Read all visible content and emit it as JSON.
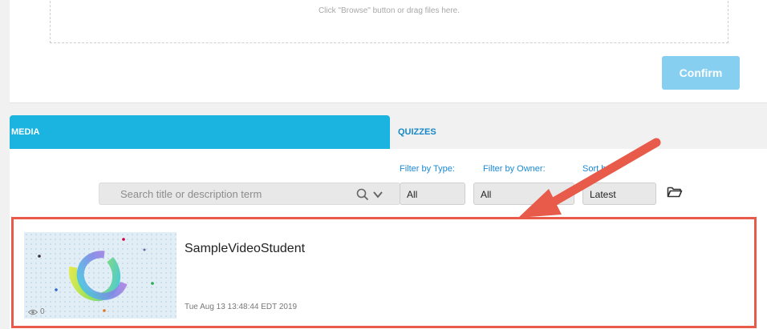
{
  "upload": {
    "dropzone_text": "Click \"Browse\" button or drag files here.",
    "confirm_label": "Confirm"
  },
  "tabs": [
    {
      "label": "MEDIA",
      "active": true
    },
    {
      "label": "QUIZZES",
      "active": false
    }
  ],
  "search": {
    "placeholder": "Search title or description term"
  },
  "filters": {
    "type": {
      "label": "Filter by Type:",
      "value": "All"
    },
    "owner": {
      "label": "Filter by Owner:",
      "value": "All"
    },
    "sort": {
      "label": "Sort by:",
      "value": "Latest"
    }
  },
  "media_items": [
    {
      "title": "SampleVideoStudent",
      "date": "Tue Aug 13 13:48:44 EDT 2019",
      "views": "0"
    }
  ],
  "colors": {
    "accent": "#1bb3e0",
    "confirm": "#87cff0",
    "annotation": "#e85a4a"
  },
  "icons": [
    "search-icon",
    "chevron-down-icon",
    "folder-icon",
    "eye-icon",
    "arrow-annotation"
  ]
}
